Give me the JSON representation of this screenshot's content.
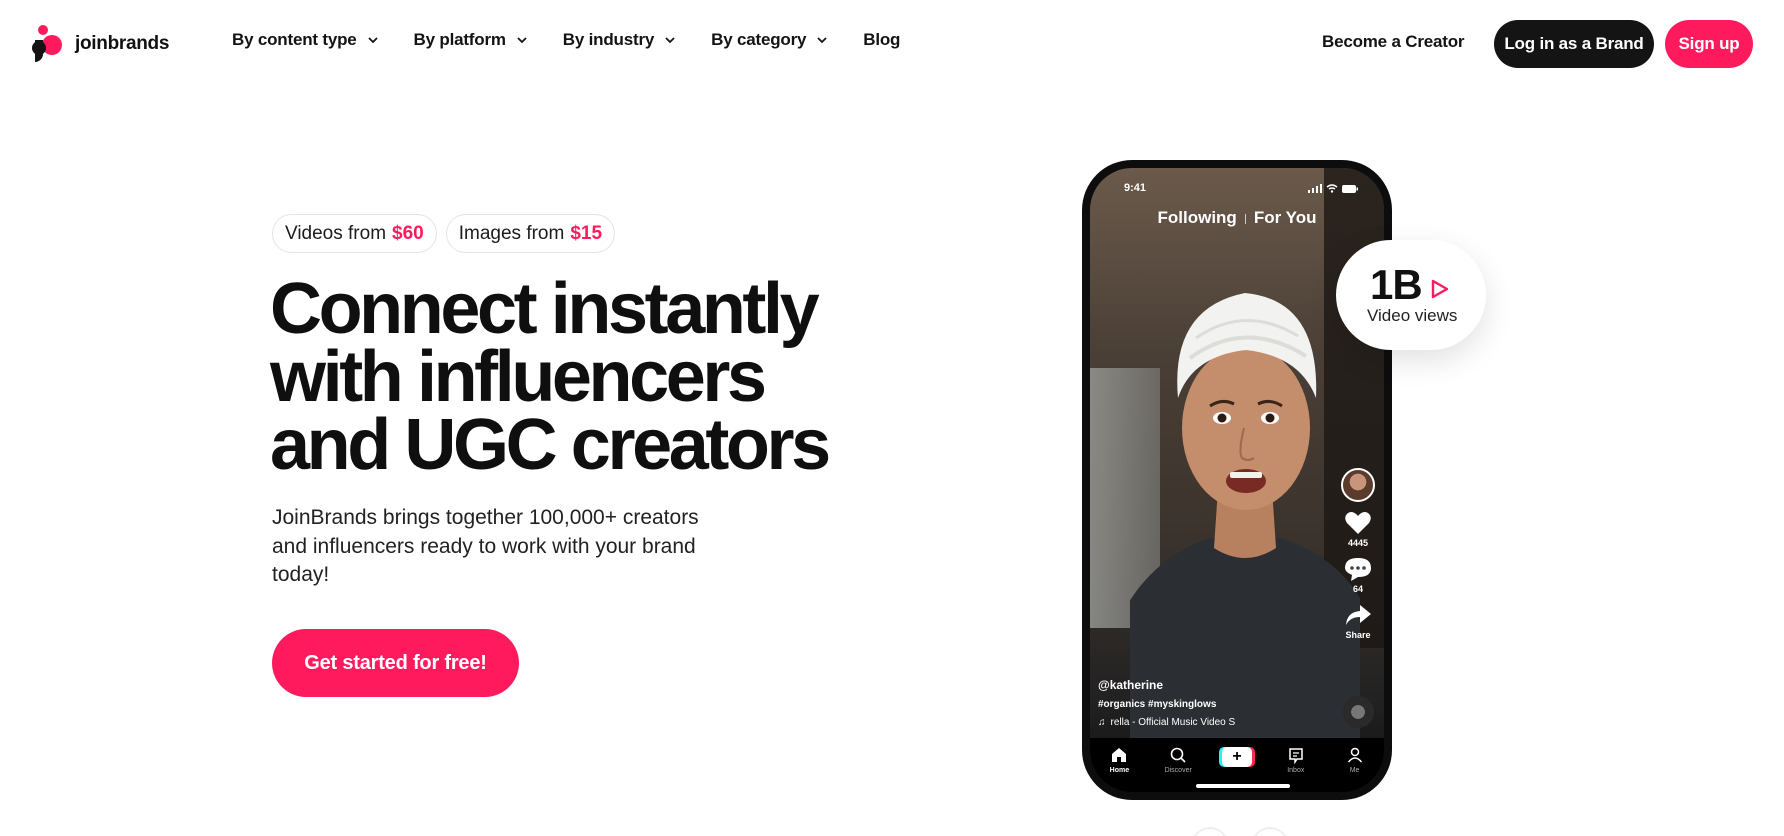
{
  "brand": {
    "name": "joinbrands",
    "accent": "#ff1a5e",
    "dark": "#141414"
  },
  "nav": {
    "items": [
      {
        "label": "By content type",
        "has_dropdown": true
      },
      {
        "label": "By platform",
        "has_dropdown": true
      },
      {
        "label": "By industry",
        "has_dropdown": true
      },
      {
        "label": "By category",
        "has_dropdown": true
      },
      {
        "label": "Blog",
        "has_dropdown": false
      }
    ],
    "creator_link": "Become a Creator",
    "login_button": "Log in as a Brand",
    "signup_button": "Sign up"
  },
  "hero": {
    "pills": [
      {
        "text": "Videos from",
        "price": "$60"
      },
      {
        "text": "Images from",
        "price": "$15"
      }
    ],
    "headline_lines": [
      "Connect instantly",
      "with influencers",
      "and UGC creators"
    ],
    "subtext": "JoinBrands brings together 100,000+ creators and influencers ready to work with your brand today!",
    "cta": "Get started for free!"
  },
  "phone": {
    "time": "9:41",
    "tabs": [
      "Following",
      "For You"
    ],
    "likes": "4445",
    "comments": "64",
    "share": "Share",
    "username": "@katherine",
    "hashtags": "#organics #myskinglows",
    "music": "rella - Official Music Video S",
    "tabbar": [
      "Home",
      "Discover",
      "",
      "Inbox",
      "Me"
    ]
  },
  "stats": {
    "value": "1B",
    "label": "Video views"
  }
}
